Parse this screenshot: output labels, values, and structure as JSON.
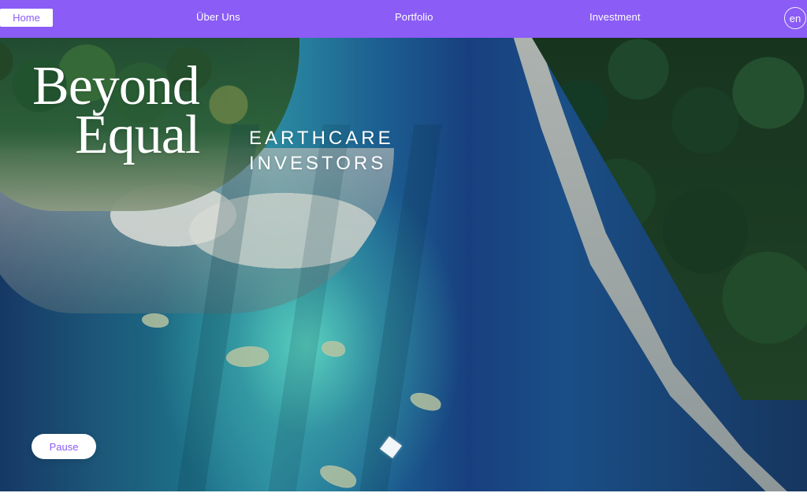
{
  "nav": {
    "items": [
      {
        "label": "Home"
      },
      {
        "label": "Über Uns"
      },
      {
        "label": "Portfolio"
      },
      {
        "label": "Investment"
      }
    ],
    "language": "en"
  },
  "hero": {
    "title_line_1": "Beyond",
    "title_line_2": "Equal",
    "subtitle_line_1": "EARTHCARE",
    "subtitle_line_2": "INVESTORS",
    "pause_label": "Pause"
  },
  "theme": {
    "accent": "#8b5cf6",
    "white": "#ffffff"
  }
}
